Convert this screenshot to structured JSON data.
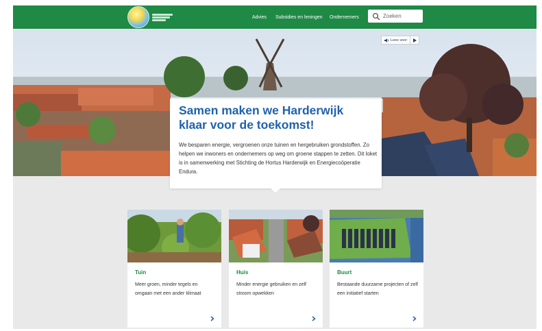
{
  "header": {
    "logo_name": "logo",
    "nav": [
      {
        "label": "Advies"
      },
      {
        "label": "Subsidies en leningen"
      },
      {
        "label": "Ondernemers"
      }
    ],
    "search": {
      "placeholder": "Zoeken",
      "icon": "search-icon"
    }
  },
  "hero": {
    "lees_voor": {
      "label": "Lees voor",
      "speaker_icon": "speaker-icon",
      "play_icon": "play-icon"
    }
  },
  "intro": {
    "title_line1": "Samen maken we Harderwijk",
    "title_line2": "klaar voor de toekomst!",
    "text": "We besparen energie, vergroenen onze tuinen en hergebruiken grondstoffen. Zo helpen we inwoners en ondernemers op weg om groene stappen te zetten. Dit loket is in samenwerking met Stichting de Hortus Harderwijk en Energiecoöperatie Endura."
  },
  "cards": [
    {
      "title": "Tuin",
      "text": "Meer groen, minder tegels en omgaan met een ander klimaat",
      "arrow_icon": "chevron-right-icon"
    },
    {
      "title": "Huis",
      "text": "Minder energie gebruiken en zelf stroom opwekken",
      "arrow_icon": "chevron-right-icon"
    },
    {
      "title": "Buurt",
      "text": "Bestaande duurzame projecten of zelf een initiatief starten",
      "arrow_icon": "chevron-right-icon"
    }
  ],
  "colors": {
    "brand_green": "#1e8a45",
    "title_blue": "#1f62ad",
    "background": "#e9e9e9"
  }
}
